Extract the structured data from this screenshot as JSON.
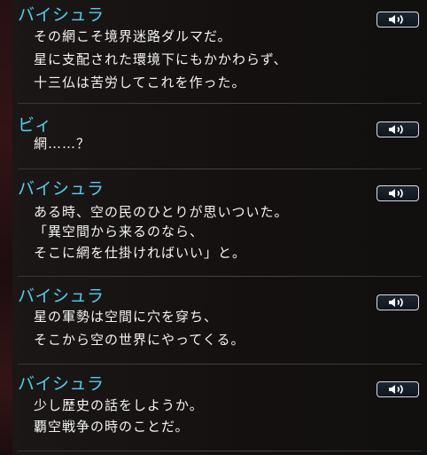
{
  "log_entries": [
    {
      "speaker": "バイシュラ",
      "lines": [
        "その網こそ境界迷路ダルマだ。",
        "星に支配された環境下にもかかわらず、",
        "十三仏は苦労してこれを作った。"
      ],
      "voice_icon": "speaker-icon"
    },
    {
      "speaker": "ビィ",
      "lines": [
        "網……？"
      ],
      "voice_icon": "speaker-icon"
    },
    {
      "speaker": "バイシュラ",
      "lines": [
        "ある時、空の民のひとりが思いついた。",
        "「異空間から来るのなら、",
        "そこに網を仕掛ければいい」と。"
      ],
      "voice_icon": "speaker-icon"
    },
    {
      "speaker": "バイシュラ",
      "lines": [
        "星の軍勢は空間に穴を穿ち、",
        "そこから空の世界にやってくる。"
      ],
      "voice_icon": "speaker-icon"
    },
    {
      "speaker": "バイシュラ",
      "lines": [
        "少し歴史の話をしようか。",
        "覇空戦争の時のことだ。"
      ],
      "voice_icon": "speaker-icon"
    }
  ],
  "colors": {
    "speaker": "#4fd0ee",
    "text": "#f2f2f2",
    "background": "#161212"
  }
}
